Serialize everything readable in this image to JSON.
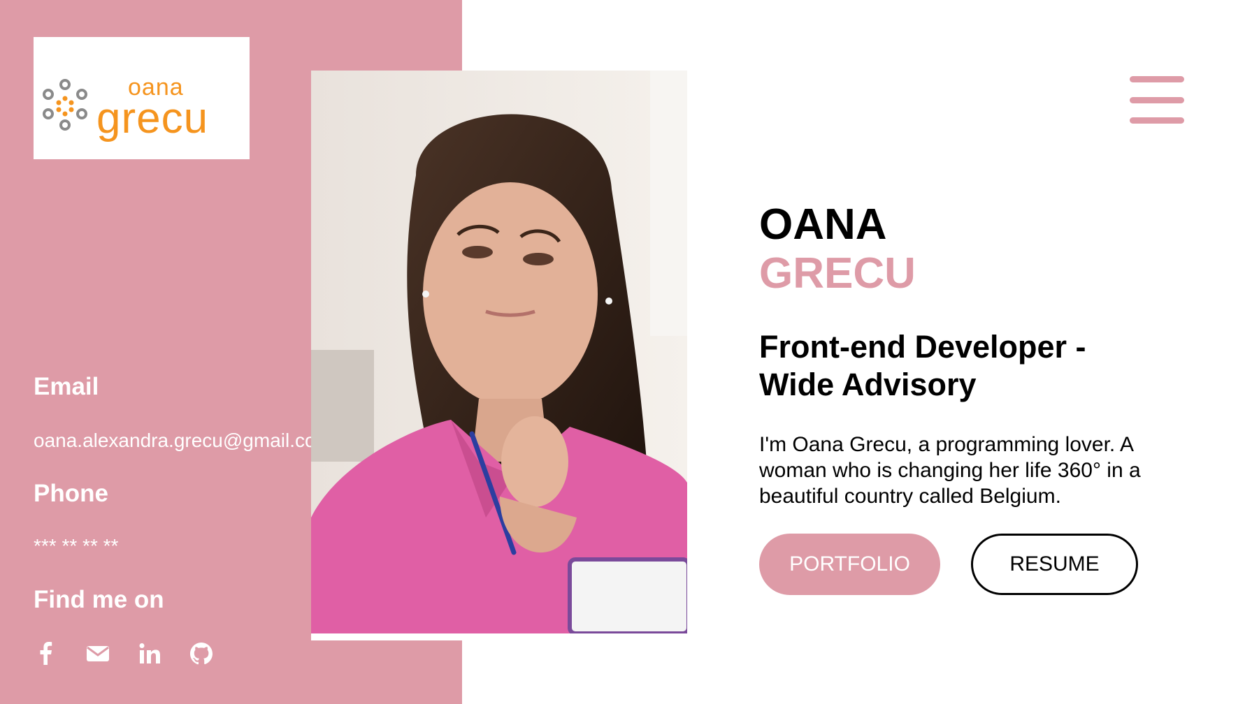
{
  "logo": {
    "top_word": "oana",
    "bottom_word": "grecu",
    "brand_color": "#f5941e",
    "icon": "dots-logo-icon"
  },
  "contact": {
    "email_heading": "Email",
    "email_value": "oana.alexandra.grecu@gmail.com",
    "phone_heading": "Phone",
    "phone_value": "*** ** ** **",
    "find_heading": "Find me on",
    "social_icons": [
      "facebook-icon",
      "email-icon",
      "linkedin-icon",
      "github-icon"
    ]
  },
  "hero": {
    "first_name": "OANA",
    "last_name": "GRECU",
    "role": "Front-end Developer - Wide Advisory",
    "bio": "I'm Oana Grecu, a programming lover. A woman who is changing her life 360° in a beautiful country called Belgium.",
    "portfolio_label": "PORTFOLIO",
    "resume_label": "RESUME"
  },
  "colors": {
    "accent": "#de9ba7",
    "text": "#000000",
    "background": "#ffffff"
  },
  "icons": {
    "menu": "hamburger-menu-icon"
  }
}
